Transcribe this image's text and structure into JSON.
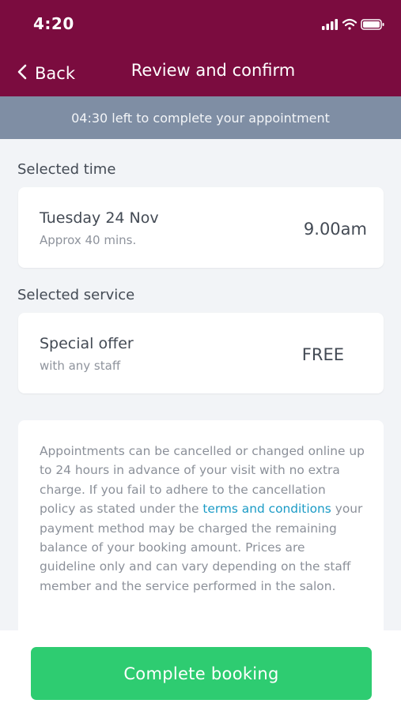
{
  "status_bar": {
    "time": "4:20"
  },
  "nav": {
    "back_label": "Back",
    "title": "Review and confirm"
  },
  "timer_text": "04:30 left to complete your appointment",
  "selected_time": {
    "section_label": "Selected time",
    "date": "Tuesday 24 Nov",
    "duration": "Approx 40 mins.",
    "time": "9.00am"
  },
  "selected_service": {
    "section_label": "Selected service",
    "name": "Special offer",
    "staff": "with any staff",
    "price": "FREE"
  },
  "policy": {
    "text_before": "Appointments can be cancelled or changed online up to 24 hours in advance of your visit with no extra charge. If you fail to adhere to the cancellation policy as stated under the ",
    "link_text": "terms and conditions",
    "text_after": " your payment method may be charged the remaining balance of your booking amount. Prices are guideline only and can vary depending on the staff member and the service performed in the salon."
  },
  "cta_label": "Complete booking",
  "colors": {
    "header": "#7b0c3f",
    "timer_bar": "#7f8ea4",
    "cta": "#2ecc71",
    "link": "#1b9bc6"
  }
}
